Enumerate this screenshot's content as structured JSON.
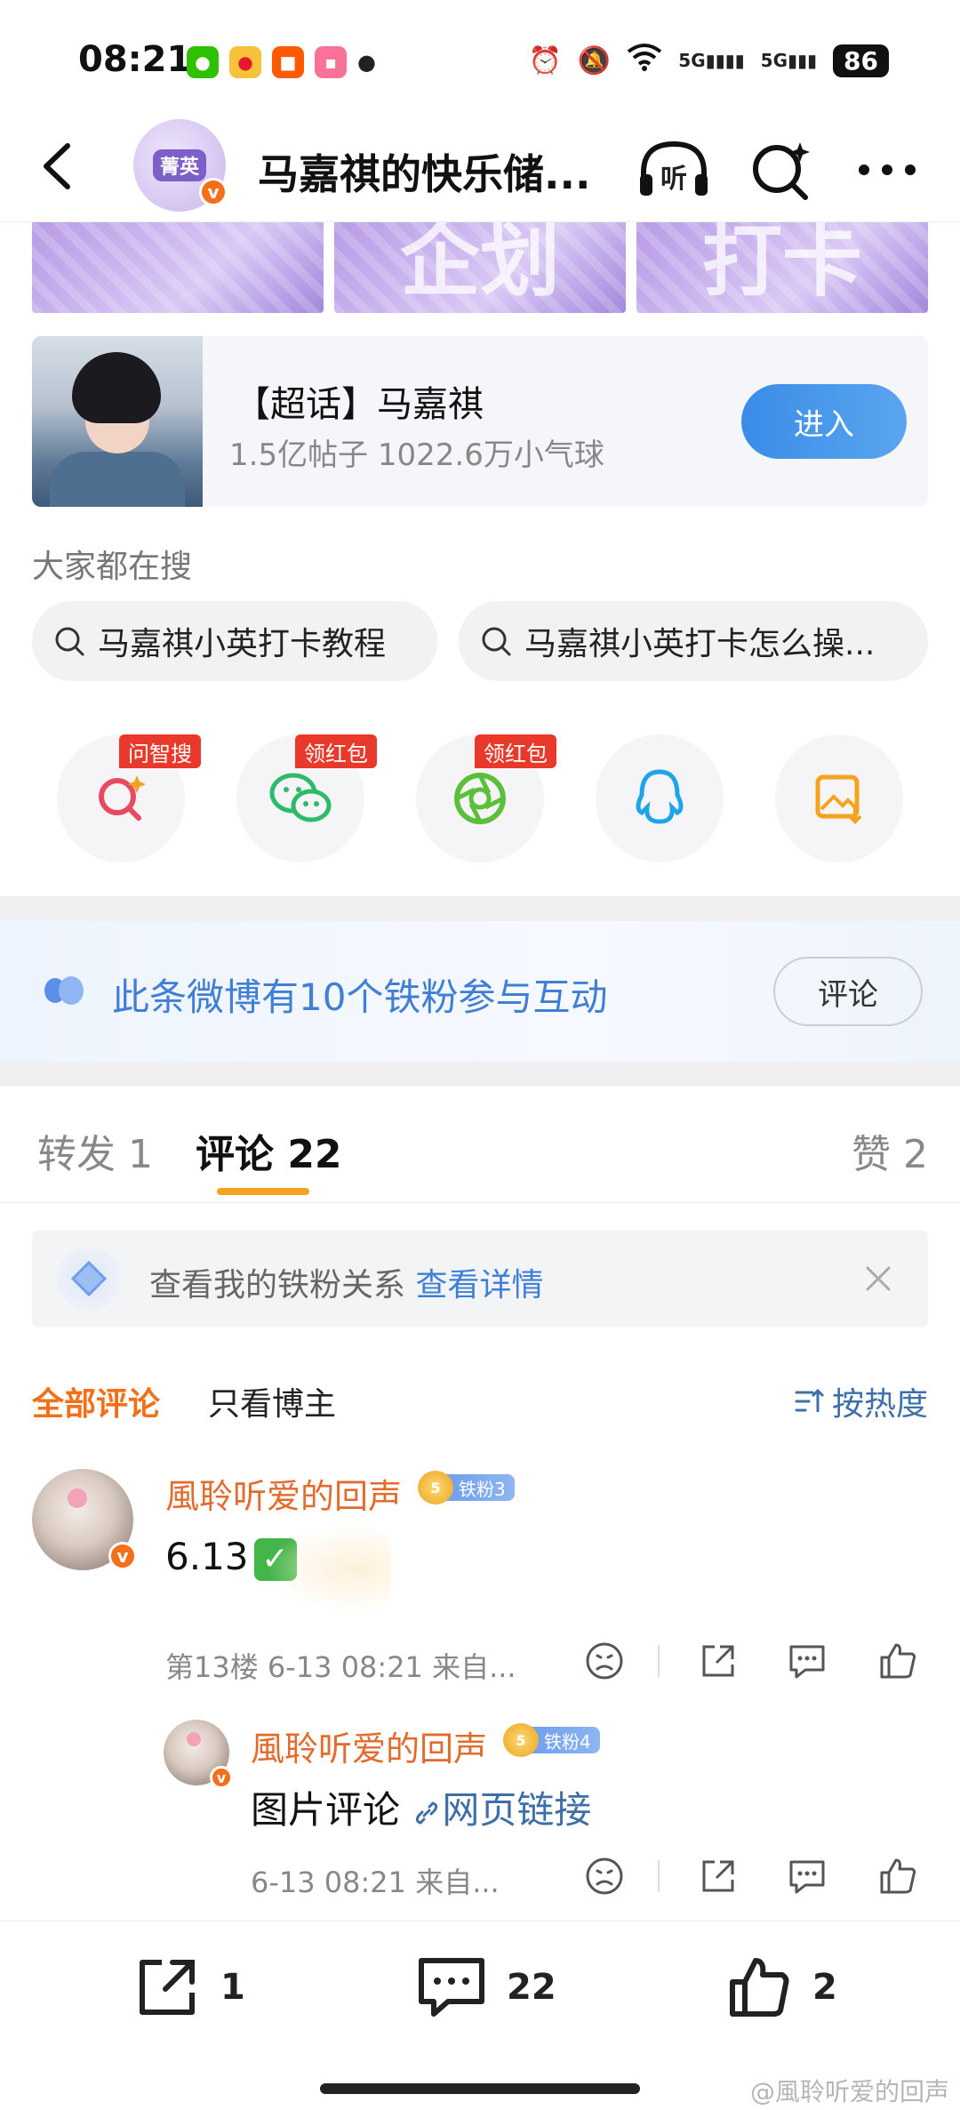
{
  "status_bar": {
    "time": "08:21",
    "battery": "86",
    "signal_1": "5G",
    "signal_2": "5G"
  },
  "nav": {
    "avatar_badge": "菁英",
    "title": "马嘉祺的快乐储...",
    "listen_label": "听"
  },
  "banner": {
    "cells": [
      "",
      "企划",
      "打卡"
    ]
  },
  "supertopic": {
    "name": "【超话】马嘉祺",
    "meta": "1.5亿帖子 1022.6万小气球",
    "enter_label": "进入"
  },
  "search": {
    "heading": "大家都在搜",
    "chips": [
      "马嘉祺小英打卡教程",
      "马嘉祺小英打卡怎么操..."
    ]
  },
  "share_row": {
    "tags": [
      "问智搜",
      "领红包",
      "领红包"
    ],
    "items": [
      "ai-search-icon",
      "wechat-icon",
      "moments-icon",
      "qq-icon",
      "save-image-icon"
    ]
  },
  "fan_banner": {
    "text": "此条微博有10个铁粉参与互动",
    "button": "评论"
  },
  "tabs": {
    "repost": "转发 1",
    "comments": "评论 22",
    "likes": "赞 2"
  },
  "relation_bar": {
    "text": "查看我的铁粉关系",
    "link": "查看详情"
  },
  "filters": {
    "all": "全部评论",
    "owner_only": "只看博主",
    "sort": "按热度"
  },
  "comments": [
    {
      "user": "風聆听爱的回声",
      "fan_level": "铁粉3",
      "crown_level": "5",
      "text": "6.13",
      "meta": "第13楼  6-13 08:21  来自..."
    },
    {
      "user": "風聆听爱的回声",
      "fan_level": "铁粉4",
      "crown_level": "5",
      "text": "图片评论",
      "link": "网页链接",
      "meta": "6-13 08:21  来自..."
    }
  ],
  "bottom_bar": {
    "repost_count": "1",
    "comment_count": "22",
    "like_count": "2"
  },
  "watermark": "@風聆听爱的回声",
  "colors": {
    "accent_orange": "#f36f1a",
    "link_blue": "#3f7fd6",
    "enter_button": "#3a8ce8",
    "tab_indicator": "#f5a31e",
    "banner_purple": "#b89be6"
  }
}
